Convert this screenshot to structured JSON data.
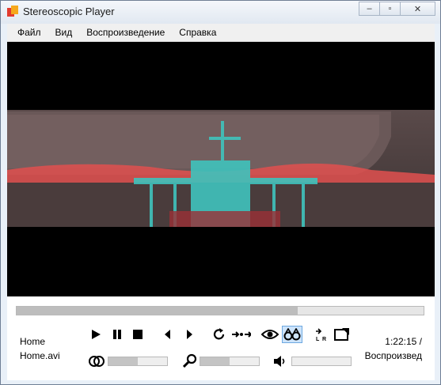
{
  "window": {
    "title": "Stereoscopic Player",
    "minimize_label": "‒",
    "maximize_label": "▫",
    "close_label": "✕"
  },
  "menu": [
    "Файл",
    "Вид",
    "Воспроизведение",
    "Справка"
  ],
  "playback": {
    "file_line1": "Home",
    "file_line2": "Home.avi",
    "time": "1:22:15 /",
    "status": "Воспроизвед",
    "seek_fraction": 0.69,
    "balance_fraction": 0.5,
    "zoom_fraction": 0.5,
    "volume_fraction": 0.0
  },
  "colors": {
    "accent": "#cde4fb",
    "video_red": "#e0504f",
    "video_cyan": "#3fc3bd"
  }
}
